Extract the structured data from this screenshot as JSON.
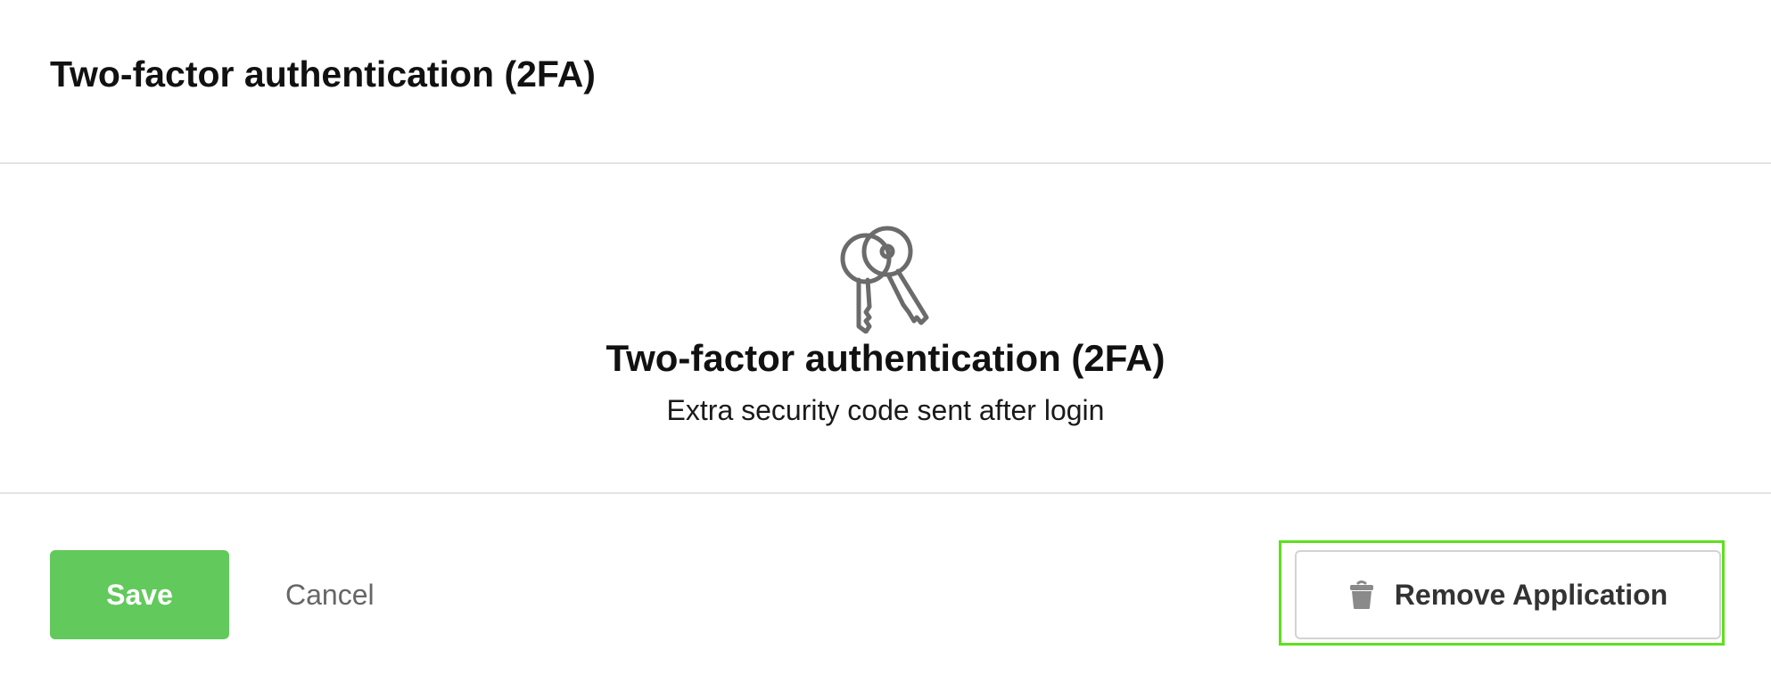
{
  "header": {
    "title": "Two-factor authentication (2FA)"
  },
  "hero": {
    "icon": "keys-icon",
    "title": "Two-factor authentication (2FA)",
    "subtitle": "Extra security code sent after login"
  },
  "footer": {
    "save_label": "Save",
    "cancel_label": "Cancel",
    "remove_label": "Remove Application",
    "remove_icon": "trash-icon"
  },
  "colors": {
    "save_bg": "#62c95c",
    "highlight": "#5ee01e",
    "icon_gray": "#6b6b6b"
  }
}
